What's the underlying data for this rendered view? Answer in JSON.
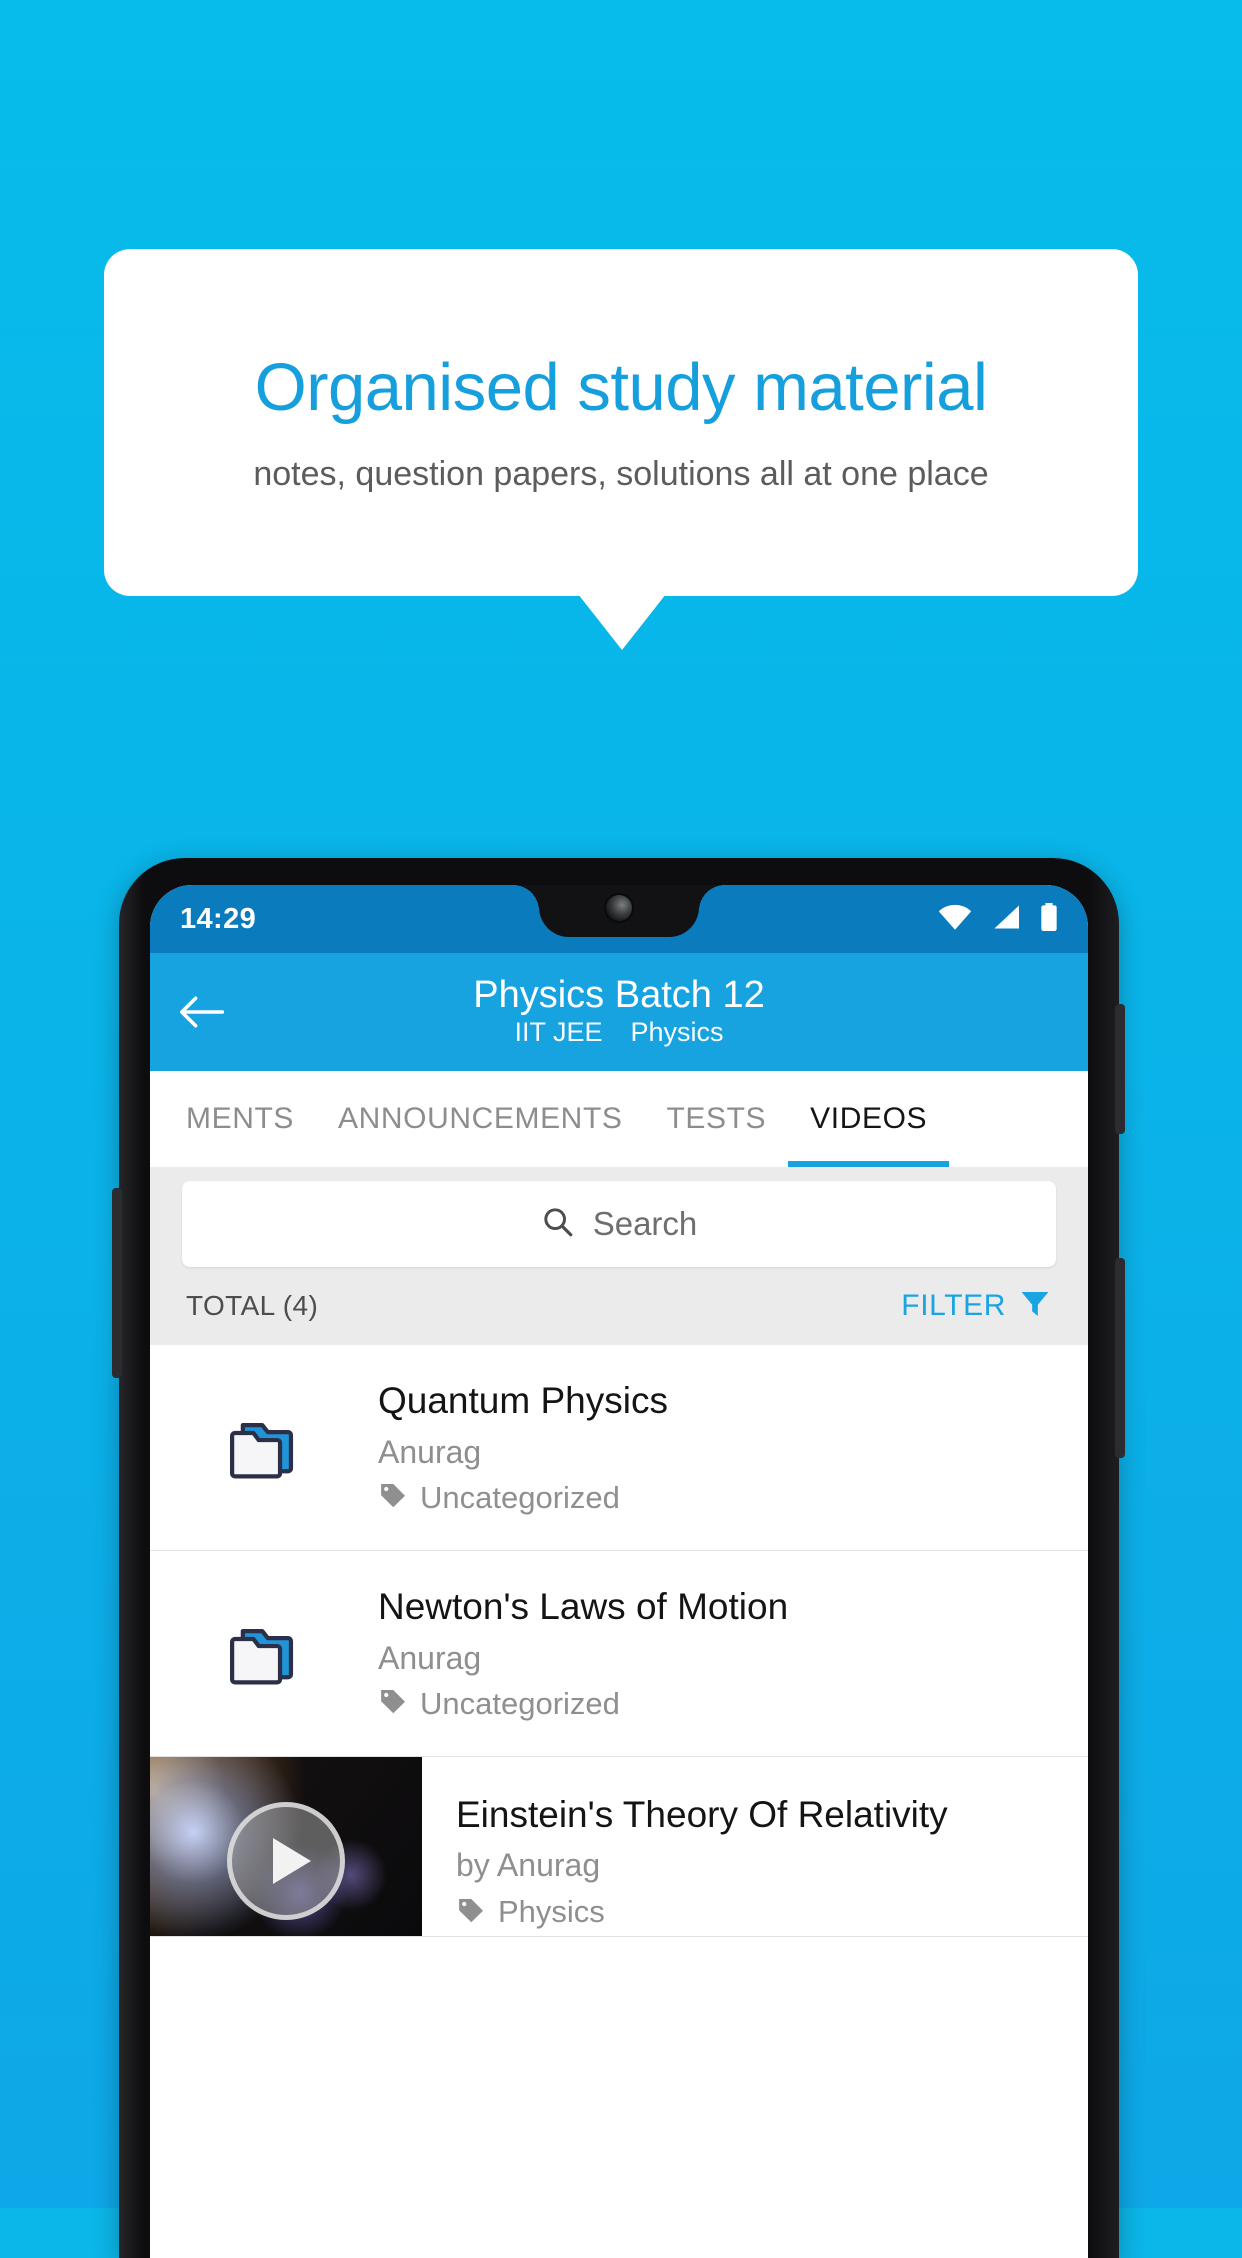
{
  "promo": {
    "title": "Organised study material",
    "subtitle": "notes, question papers, solutions all at one place",
    "title_color": "#159fdd",
    "background_top": "#06bcea",
    "background_bottom": "#0ea7e7"
  },
  "phone": {
    "status_bar": {
      "time": "14:29",
      "icons": [
        "wifi-icon",
        "signal-icon",
        "battery-icon"
      ],
      "background_color": "#0a7cbd"
    },
    "app_bar": {
      "back_icon": "back-arrow-icon",
      "title": "Physics Batch 12",
      "subtitle_exam": "IIT JEE",
      "subtitle_subject": "Physics",
      "background_color": "#17a3e0"
    },
    "tabs": [
      {
        "label": "MENTS",
        "active": false
      },
      {
        "label": "ANNOUNCEMENTS",
        "active": false
      },
      {
        "label": "TESTS",
        "active": false
      },
      {
        "label": "VIDEOS",
        "active": true
      }
    ],
    "search": {
      "icon": "search-icon",
      "placeholder": "Search",
      "value": ""
    },
    "toolbar": {
      "total_label": "TOTAL (4)",
      "filter_label": "FILTER",
      "filter_icon": "filter-funnel-icon",
      "filter_color": "#1aa5e2"
    },
    "items": [
      {
        "type": "folder",
        "icon": "folder-icon",
        "title": "Quantum Physics",
        "author": "Anurag",
        "tag_icon": "tag-icon",
        "tag": "Uncategorized"
      },
      {
        "type": "folder",
        "icon": "folder-icon",
        "title": "Newton's Laws of Motion",
        "author": "Anurag",
        "tag_icon": "tag-icon",
        "tag": "Uncategorized"
      },
      {
        "type": "video",
        "icon": "play-button-icon",
        "title": "Einstein's Theory Of Relativity",
        "author": "by Anurag",
        "tag_icon": "tag-icon",
        "tag": "Physics"
      }
    ]
  }
}
